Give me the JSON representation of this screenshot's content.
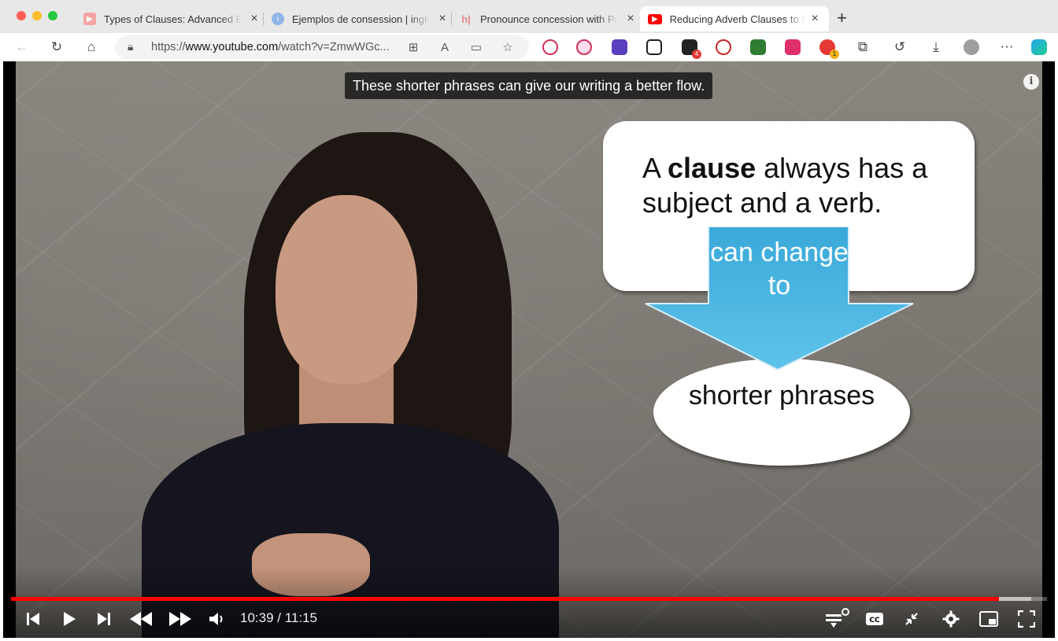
{
  "browser": {
    "tabs": [
      {
        "title": "Types of Clauses: Advanced English Grammar",
        "favicon": "youtube-icon",
        "active": false
      },
      {
        "title": "Ejemplos de consession | inglés",
        "favicon": "info-icon",
        "active": false
      },
      {
        "title": "Pronounce concession with Precision",
        "favicon": "bookmark-icon",
        "active": false
      },
      {
        "title": "Reducing Adverb Clauses to Phrases",
        "favicon": "youtube-icon",
        "active": true
      }
    ],
    "url_prefix": "https://",
    "url_domain": "www.youtube.com",
    "url_path": "/watch?v=ZmwWGc...",
    "extension_badges": {
      "ext5": "4",
      "ext10": "1"
    }
  },
  "video": {
    "caption": "These shorter phrases can give our writing a better flow.",
    "slide": {
      "bubble_pre": "A ",
      "bubble_bold": "clause",
      "bubble_post": " always has a subject and a verb.",
      "arrow_text": "can change to",
      "oval_text": "shorter phrases"
    },
    "current_time": "10:39",
    "duration": "11:15",
    "progress_fraction": 0.954,
    "buffered_fraction": 0.985
  },
  "colors": {
    "progress": "#ff0000",
    "arrow": "#3aa9d9"
  }
}
